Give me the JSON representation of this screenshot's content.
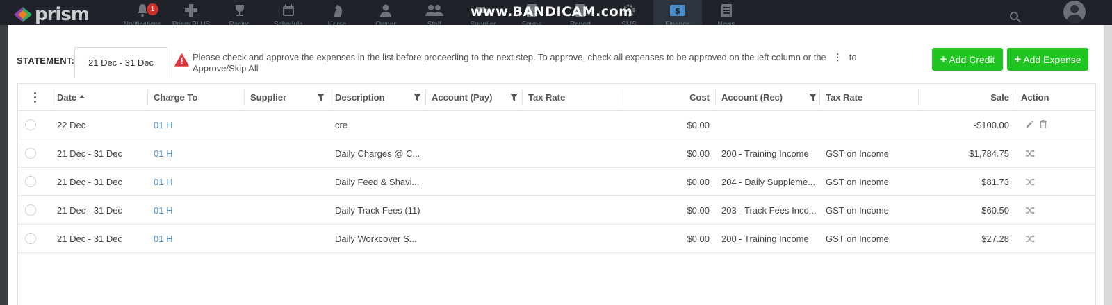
{
  "nav": {
    "items": [
      {
        "name": "notifications",
        "label": "Notifications",
        "badge": "1"
      },
      {
        "name": "prism-plus",
        "label": "Prism PLUS"
      },
      {
        "name": "racing",
        "label": "Racing"
      },
      {
        "name": "schedule",
        "label": "Schedule"
      },
      {
        "name": "horse",
        "label": "Horse"
      },
      {
        "name": "owner",
        "label": "Owner"
      },
      {
        "name": "staff",
        "label": "Staff"
      },
      {
        "name": "supplier",
        "label": "Supplier"
      },
      {
        "name": "forms",
        "label": "Forms"
      },
      {
        "name": "report",
        "label": "Report"
      },
      {
        "name": "sms",
        "label": "SMS"
      },
      {
        "name": "finance",
        "label": "Finance",
        "active": true
      },
      {
        "name": "news",
        "label": "News"
      }
    ],
    "logo_text": "prism",
    "watermark": "www.BANDICAM.com"
  },
  "statement": {
    "label": "STATEMENT:",
    "tab": "21 Dec - 31 Dec",
    "warning_before": "Please check and approve the expenses in the list before proceeding to the next step. To approve, check all expenses to be approved on the left column or the",
    "warning_after": "to",
    "warning_line2": "Approve/Skip All"
  },
  "buttons": {
    "add_credit": "Add Credit",
    "add_expense": "Add Expense"
  },
  "table": {
    "headers": {
      "date": "Date",
      "charge_to": "Charge To",
      "supplier": "Supplier",
      "description": "Description",
      "account_pay": "Account (Pay)",
      "tax_rate_pay": "Tax Rate",
      "cost": "Cost",
      "account_rec": "Account (Rec)",
      "tax_rate_rec": "Tax Rate",
      "sale": "Sale",
      "action": "Action"
    },
    "rows": [
      {
        "date": "22 Dec",
        "charge_to": "01 H",
        "supplier": "",
        "description": "cre",
        "account_pay": "",
        "tax_rate_pay": "",
        "cost": "$0.00",
        "account_rec": "",
        "tax_rate_rec": "",
        "sale": "-$100.00",
        "action": "edit-delete"
      },
      {
        "date": "21 Dec - 31 Dec",
        "charge_to": "01 H",
        "supplier": "",
        "description": "Daily Charges @ C...",
        "account_pay": "",
        "tax_rate_pay": "",
        "cost": "$0.00",
        "account_rec": "200 - Training Income",
        "tax_rate_rec": "GST on Income",
        "sale": "$1,784.75",
        "action": "shuffle"
      },
      {
        "date": "21 Dec - 31 Dec",
        "charge_to": "01 H",
        "supplier": "",
        "description": "Daily Feed & Shavi...",
        "account_pay": "",
        "tax_rate_pay": "",
        "cost": "$0.00",
        "account_rec": "204 - Daily Suppleme...",
        "tax_rate_rec": "GST on Income",
        "sale": "$81.73",
        "action": "shuffle"
      },
      {
        "date": "21 Dec - 31 Dec",
        "charge_to": "01 H",
        "supplier": "",
        "description": "Daily Track Fees (11)",
        "account_pay": "",
        "tax_rate_pay": "",
        "cost": "$0.00",
        "account_rec": "203 - Track Fees Inco...",
        "tax_rate_rec": "GST on Income",
        "sale": "$60.50",
        "action": "shuffle"
      },
      {
        "date": "21 Dec - 31 Dec",
        "charge_to": "01 H",
        "supplier": "",
        "description": "Daily Workcover S...",
        "account_pay": "",
        "tax_rate_pay": "",
        "cost": "$0.00",
        "account_rec": "200 - Training Income",
        "tax_rate_rec": "GST on Income",
        "sale": "$27.28",
        "action": "shuffle"
      }
    ]
  },
  "colors": {
    "accent_green": "#21c521",
    "link_blue": "#4a8cc7",
    "warning_red": "#d9363e",
    "nav_bg": "#1f2329"
  }
}
